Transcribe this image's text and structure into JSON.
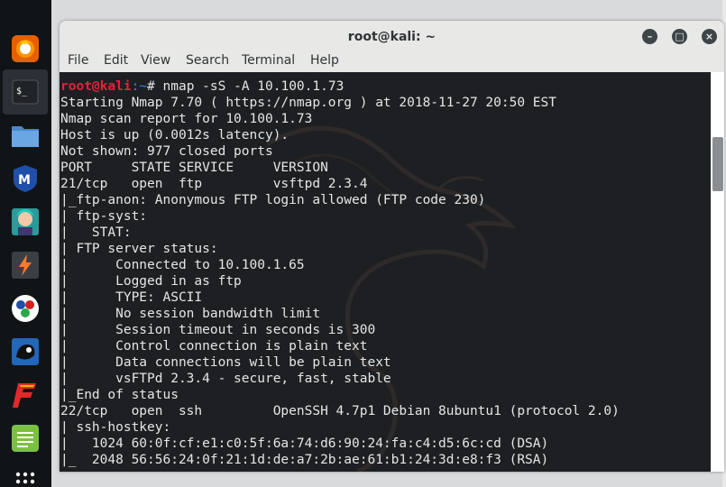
{
  "dock": {
    "items": [
      {
        "name": "firefox-icon"
      },
      {
        "name": "terminal-icon"
      },
      {
        "name": "files-icon"
      },
      {
        "name": "metasploit-icon"
      },
      {
        "name": "armitage-icon"
      },
      {
        "name": "burpsuite-icon"
      },
      {
        "name": "maltego-icon"
      },
      {
        "name": "beef-icon"
      },
      {
        "name": "faraday-icon"
      },
      {
        "name": "notes-icon"
      },
      {
        "name": "app-grid-icon"
      }
    ]
  },
  "window": {
    "title": "root@kali: ~",
    "buttons": {
      "minimize": "–",
      "maximize": "□",
      "close": "×"
    }
  },
  "menubar": [
    "File",
    "Edit",
    "View",
    "Search",
    "Terminal",
    "Help"
  ],
  "terminal": {
    "prompt_user": "root@kali",
    "prompt_path": ":~",
    "prompt_symbol": "# ",
    "command": "nmap -sS -A 10.100.1.73",
    "output": "Starting Nmap 7.70 ( https://nmap.org ) at 2018-11-27 20:50 EST\nNmap scan report for 10.100.1.73\nHost is up (0.0012s latency).\nNot shown: 977 closed ports\nPORT     STATE SERVICE     VERSION\n21/tcp   open  ftp         vsftpd 2.3.4\n|_ftp-anon: Anonymous FTP login allowed (FTP code 230)\n| ftp-syst:\n|   STAT:\n| FTP server status:\n|      Connected to 10.100.1.65\n|      Logged in as ftp\n|      TYPE: ASCII\n|      No session bandwidth limit\n|      Session timeout in seconds is 300\n|      Control connection is plain text\n|      Data connections will be plain text\n|      vsFTPd 2.3.4 - secure, fast, stable\n|_End of status\n22/tcp   open  ssh         OpenSSH 4.7p1 Debian 8ubuntu1 (protocol 2.0)\n| ssh-hostkey:\n|   1024 60:0f:cf:e1:c0:5f:6a:74:d6:90:24:fa:c4:d5:6c:cd (DSA)\n|_  2048 56:56:24:0f:21:1d:de:a7:2b:ae:61:b1:24:3d:e8:f3 (RSA)"
  },
  "colors": {
    "dock_bg": "#111417",
    "terminal_bg": "#1d1f22",
    "prompt_user": "#e0243a",
    "prompt_path": "#3b83d8",
    "text": "#e6e6e6"
  }
}
